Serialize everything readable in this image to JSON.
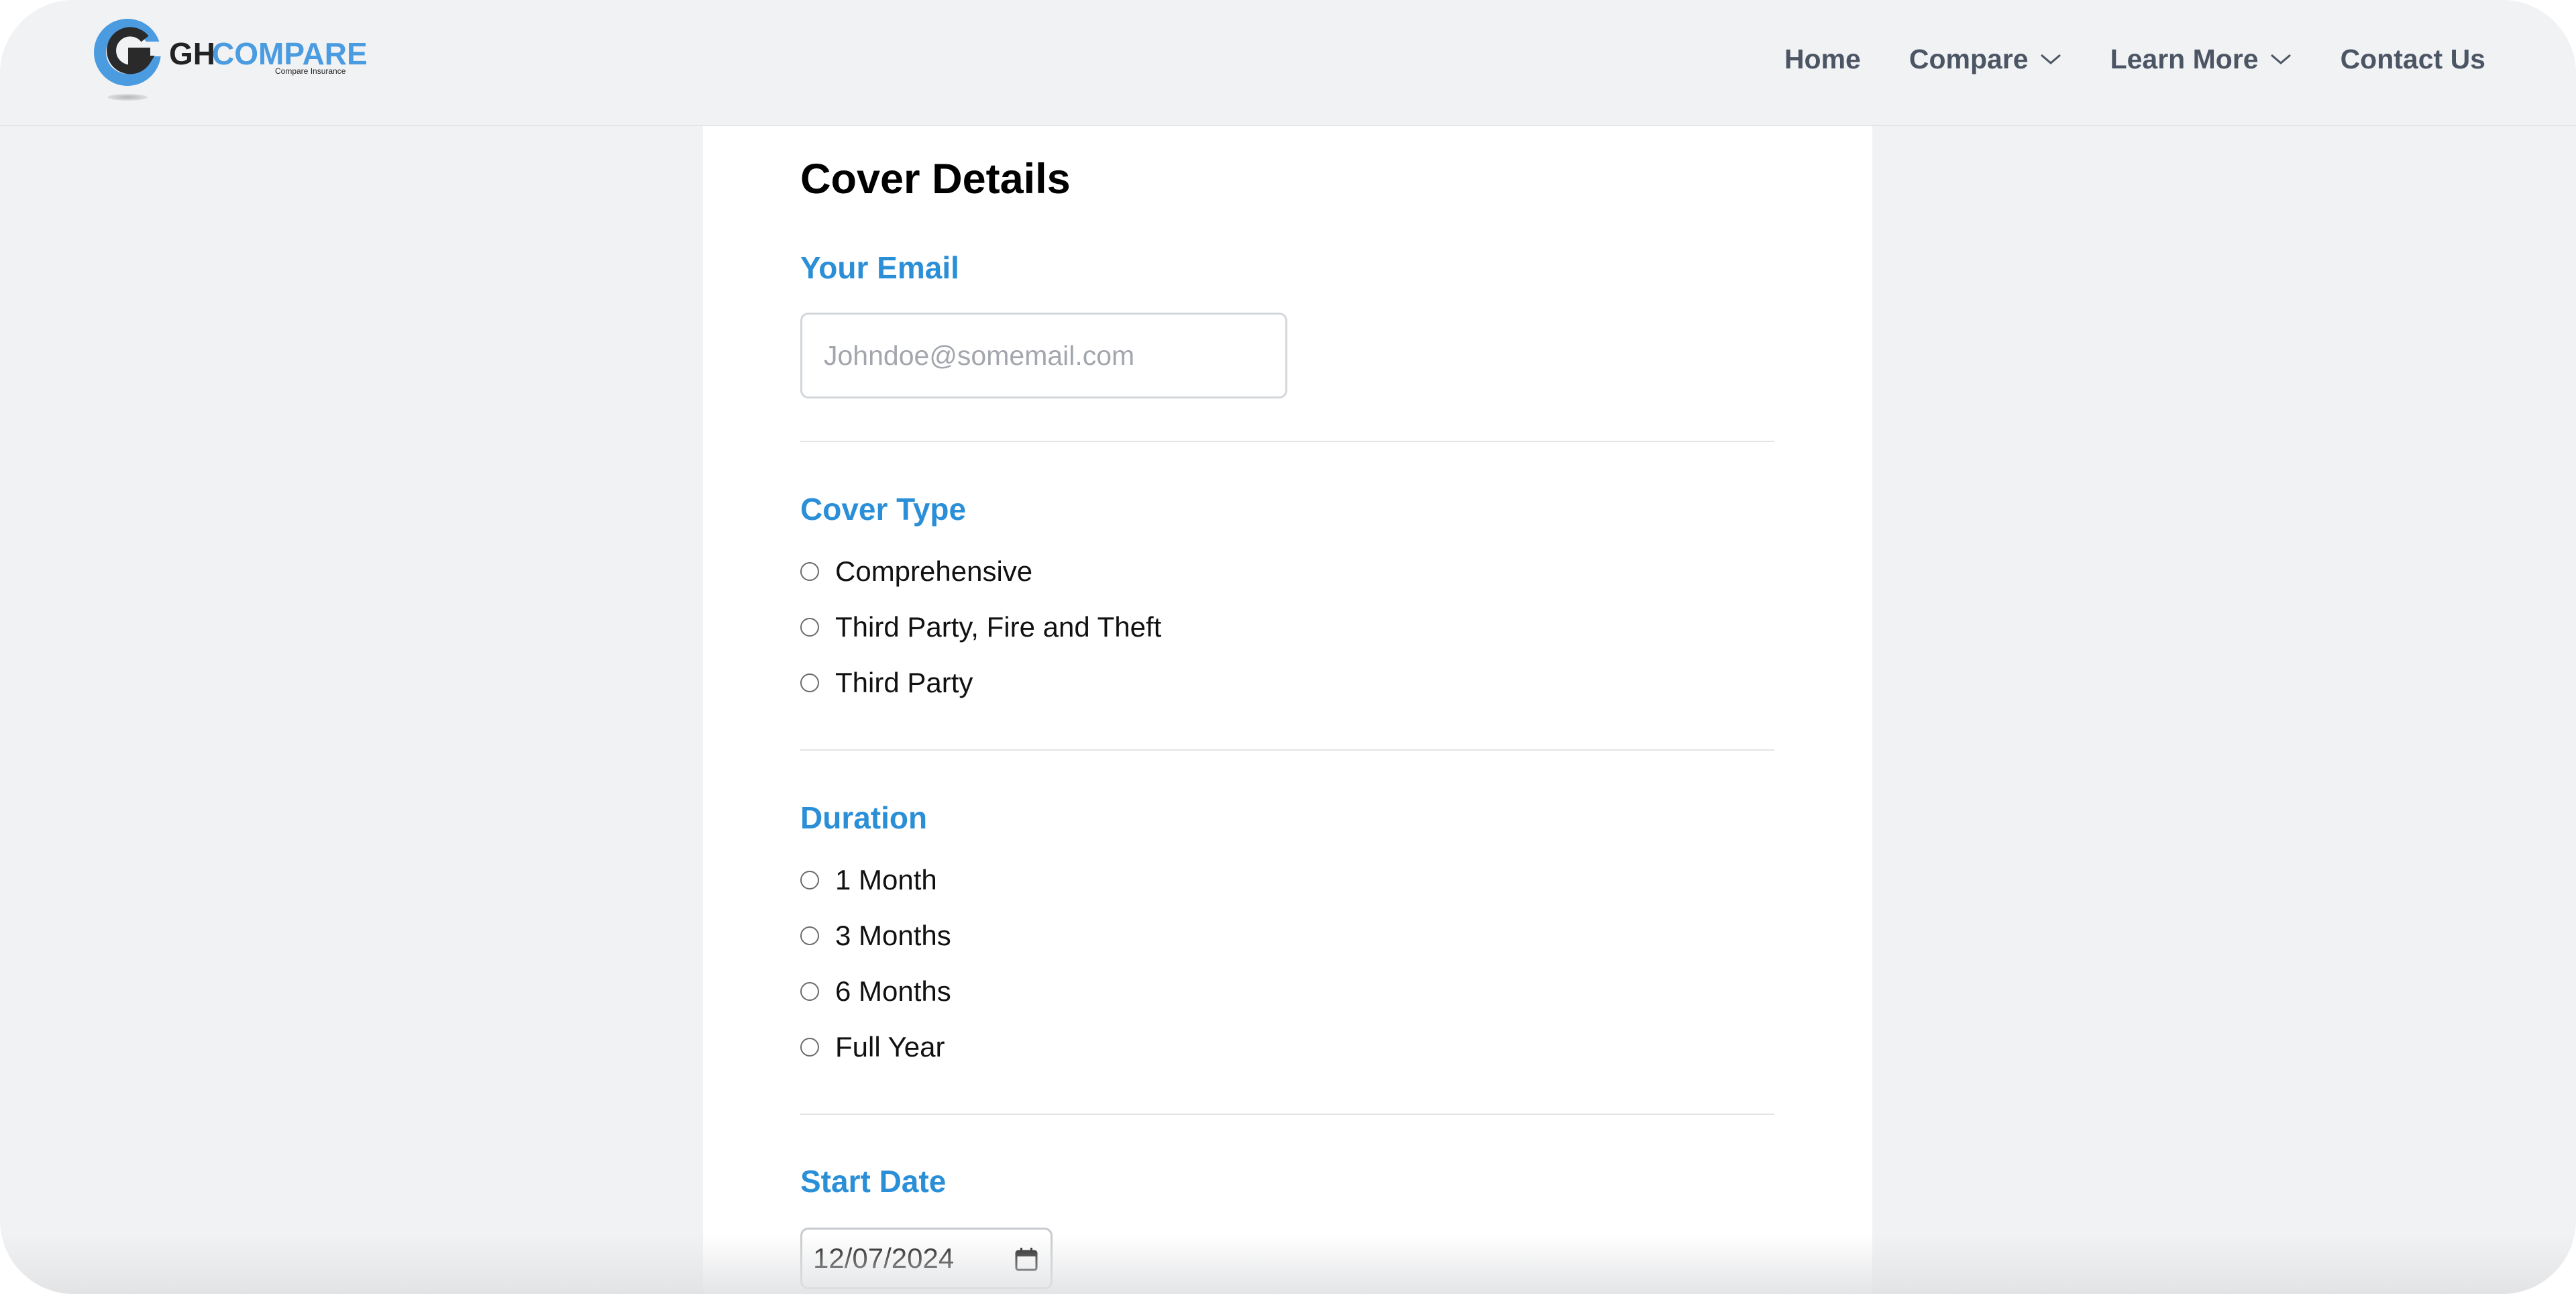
{
  "brand": {
    "logo_text_gh": "GH",
    "logo_text_compare": "COMPARE",
    "logo_tagline": "Compare Insurance",
    "accent": "#2b8fd8",
    "logo_blue": "#4a9be0"
  },
  "nav": {
    "home": "Home",
    "compare": "Compare",
    "learn_more": "Learn More",
    "contact": "Contact Us"
  },
  "form": {
    "title": "Cover Details",
    "email": {
      "label": "Your Email",
      "placeholder": "Johndoe@somemail.com",
      "value": ""
    },
    "cover_type": {
      "label": "Cover Type",
      "options": [
        "Comprehensive",
        "Third Party, Fire and Theft",
        "Third Party"
      ],
      "selected": null
    },
    "duration": {
      "label": "Duration",
      "options": [
        "1 Month",
        "3 Months",
        "6 Months",
        "Full Year"
      ],
      "selected": null
    },
    "start_date": {
      "label": "Start Date",
      "value": "12/07/2024"
    }
  }
}
